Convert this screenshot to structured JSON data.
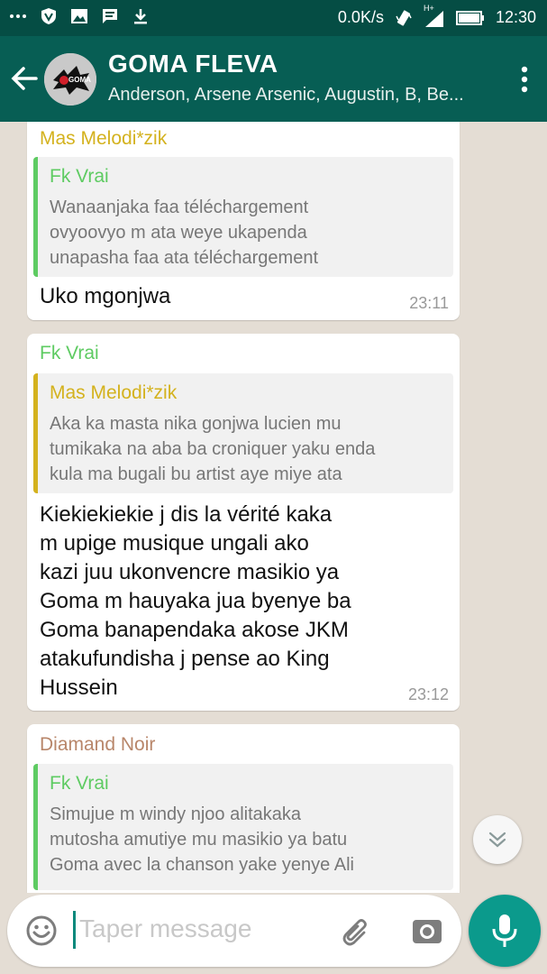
{
  "status_bar": {
    "network_speed": "0.0K/s",
    "signal_label": "H+",
    "time": "12:30"
  },
  "header": {
    "title": "GOMA FLEVA",
    "subtitle": "Anderson, Arsene Arsenic, Augustin, B, Be...",
    "avatar_text": "GOMA"
  },
  "messages": [
    {
      "sender": "Mas Melodi*zik",
      "sender_color": "#d4b21e",
      "quote_name": "Fk Vrai",
      "quote_color": "#5ecb62",
      "quote_text": "Wanaanjaka faa téléchargement\novyoovyo m ata weye ukapenda\nunapasha faa ata téléchargement",
      "text": "Uko mgonjwa",
      "time": "23:11"
    },
    {
      "sender": "Fk Vrai",
      "sender_color": "#5ecb62",
      "quote_name": "Mas Melodi*zik",
      "quote_color": "#d4b21e",
      "quote_text": "Aka ka masta nika gonjwa lucien mu\ntumikaka na aba ba croniquer yaku  enda\nkula ma bugali bu artist aye miye ata",
      "text": "Kiekiekiekie j dis la vérité kaka\nm upige musique ungali ako\nkazi juu ukonvencre masikio ya\nGoma m hauyaka jua byenye ba\nGoma banapendaka akose JKM\natakufundisha j pense ao King\nHussein",
      "time": "23:12"
    },
    {
      "sender": "Diamand Noir",
      "sender_color": "#b8866a",
      "quote_name": "Fk Vrai",
      "quote_color": "#5ecb62",
      "quote_text": "Simujue m windy njoo alitakaka\nmutosha amutiye mu masikio ya batu\nGoma avec la chanson yake yenye Ali"
    }
  ],
  "input": {
    "placeholder": "Taper message"
  },
  "colors": {
    "status_bar": "#054d44",
    "app_bar": "#075e54",
    "accent": "#0b9a8c",
    "chat_bg": "#e4ddd4"
  },
  "icons": [
    "more-icon",
    "shield-icon",
    "image-icon",
    "message-icon",
    "download-icon",
    "vibrate-icon",
    "signal-icon",
    "battery-icon",
    "back-arrow-icon",
    "overflow-menu-icon",
    "double-chevron-down-icon",
    "emoji-icon",
    "attach-icon",
    "camera-icon",
    "microphone-icon"
  ]
}
